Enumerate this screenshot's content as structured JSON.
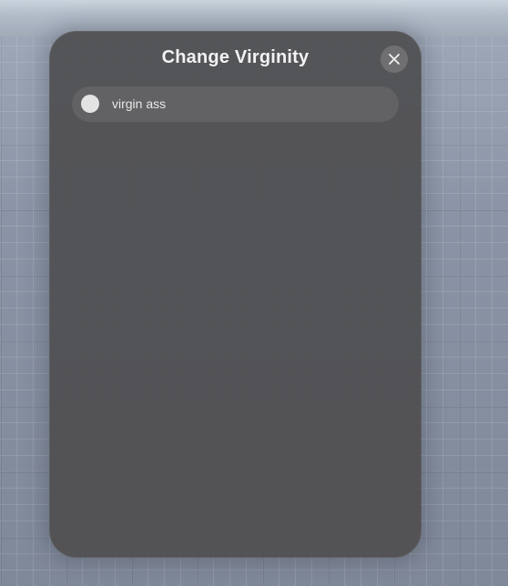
{
  "dialog": {
    "title": "Change Virginity",
    "options": [
      {
        "label": "virgin ass",
        "selected": false
      }
    ]
  },
  "icons": {
    "close": "close-icon",
    "option_radio": "radio-unselected-icon"
  },
  "colors": {
    "panel_background": "#505052",
    "title_text": "#f2f2f2",
    "radio_fill": "#e3e3e3"
  }
}
